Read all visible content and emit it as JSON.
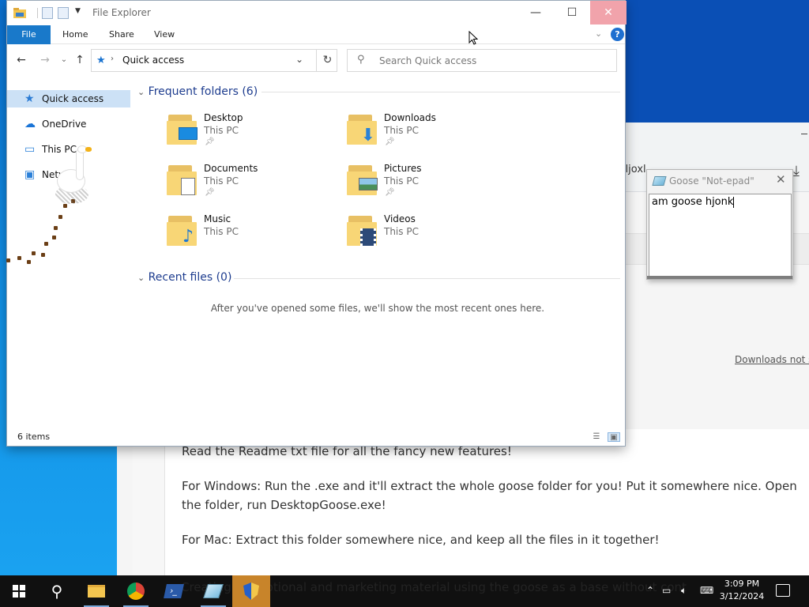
{
  "explorer": {
    "title": "File Explorer",
    "tabs": [
      "File",
      "Home",
      "Share",
      "View"
    ],
    "address": "Quick access",
    "search_placeholder": "Search Quick access",
    "help": "?",
    "nav": [
      {
        "label": "Quick access",
        "icon": "star-pin-icon"
      },
      {
        "label": "OneDrive",
        "icon": "cloud-icon"
      },
      {
        "label": "This PC",
        "icon": "computer-icon"
      },
      {
        "label": "Netwo",
        "icon": "network-icon"
      }
    ],
    "frequent_header": "Frequent folders (6)",
    "recent_header": "Recent files (0)",
    "folders": [
      {
        "name": "Desktop",
        "location": "This PC",
        "pinned": true,
        "badge": "desktop-icon"
      },
      {
        "name": "Downloads",
        "location": "This PC",
        "pinned": true,
        "badge": "download-arrow-icon"
      },
      {
        "name": "Documents",
        "location": "This PC",
        "pinned": true,
        "badge": "document-icon"
      },
      {
        "name": "Pictures",
        "location": "This PC",
        "pinned": true,
        "badge": "picture-icon"
      },
      {
        "name": "Music",
        "location": "This PC",
        "pinned": false,
        "badge": "music-note-icon"
      },
      {
        "name": "Videos",
        "location": "This PC",
        "pinned": false,
        "badge": "film-icon"
      }
    ],
    "recent_empty_message": "After you've opened some files, we'll show the most recent ones here.",
    "status": "6 items"
  },
  "notepad": {
    "title": "Goose \"Not-epad\"",
    "text": "am goose hjonk"
  },
  "browser": {
    "url_fragment": "'ljoxl",
    "downloads_link": "Downloads not sta",
    "paragraphs": [
      "Read the Readme txt file for all the fancy new features!",
      "For Windows: Run the .exe and it'll extract the whole goose folder for you! Put it somewhere nice. Open the folder, run DesktopGoose.exe!",
      "For Mac: Extract this folder somewhere nice, and keep all the files in it together!",
      "Creating promotional and marketing material using the goose as a base without cont"
    ]
  },
  "taskbar": {
    "time": "3:09 PM",
    "date": "3/12/2024",
    "apps": [
      "search-icon",
      "file-explorer-icon",
      "chrome-icon",
      "powershell-icon",
      "notepad-icon",
      "shield-icon"
    ]
  },
  "colors": {
    "accent": "#1979ca",
    "selection": "#cce1f6",
    "folder_yellow": "#f8d676",
    "taskbar": "#101010"
  }
}
